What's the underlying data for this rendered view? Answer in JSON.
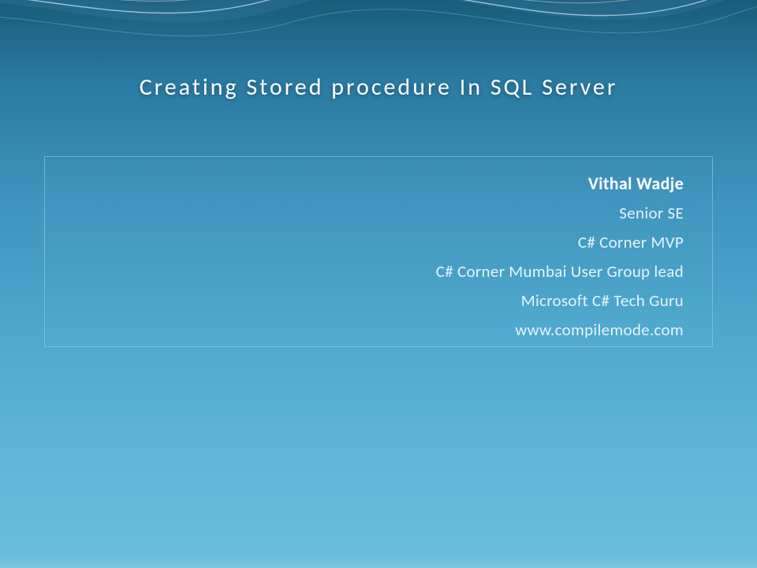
{
  "slide": {
    "title": "Creating Stored procedure In SQL Server",
    "author": "Vithal Wadje",
    "details": [
      "Senior SE",
      "C# Corner MVP",
      "C# Corner Mumbai User Group lead",
      "Microsoft  C# Tech Guru",
      "www.compilemode.com"
    ]
  }
}
